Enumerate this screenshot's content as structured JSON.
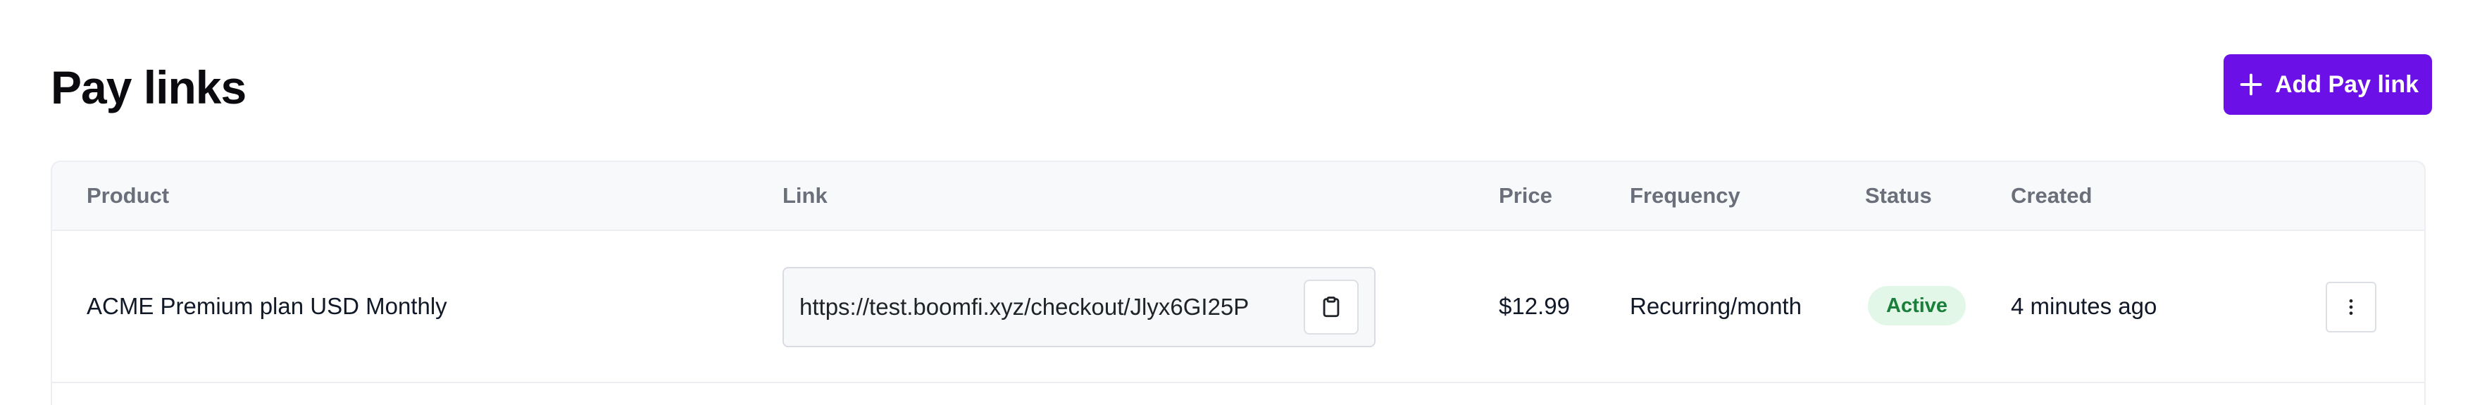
{
  "header": {
    "title": "Pay links",
    "add_button_label": "Add Pay link",
    "add_button_icon": "plus-icon",
    "accent_color": "#6b11e8"
  },
  "table": {
    "columns": [
      "Product",
      "Link",
      "Price",
      "Frequency",
      "Status",
      "Created"
    ],
    "rows": [
      {
        "product": "ACME Premium plan USD Monthly",
        "link": "https://test.boomfi.xyz/checkout/Jlyx6GI25P",
        "copy_icon": "clipboard-icon",
        "price": "$12.99",
        "frequency": "Recurring/month",
        "status": "Active",
        "status_color": "#1b7f3b",
        "created": "4 minutes ago",
        "actions_icon": "more-vertical-icon"
      }
    ]
  }
}
